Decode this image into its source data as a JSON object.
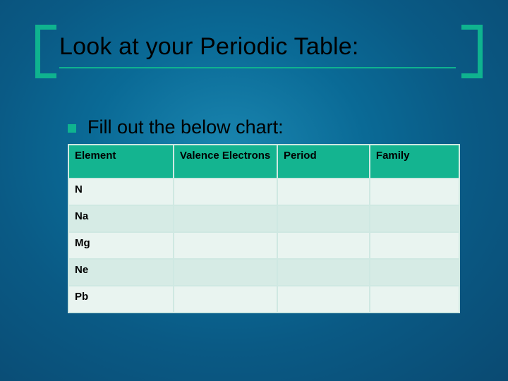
{
  "title": "Look at your Periodic Table:",
  "bullet": "Fill out the below chart:",
  "chart_data": {
    "type": "table",
    "title": "Fill out the below chart:",
    "columns": [
      "Element",
      "Valence Electrons",
      "Period",
      "Family"
    ],
    "rows": [
      {
        "element": "N",
        "valence_electrons": "",
        "period": "",
        "family": ""
      },
      {
        "element": "Na",
        "valence_electrons": "",
        "period": "",
        "family": ""
      },
      {
        "element": "Mg",
        "valence_electrons": "",
        "period": "",
        "family": ""
      },
      {
        "element": "Ne",
        "valence_electrons": "",
        "period": "",
        "family": ""
      },
      {
        "element": "Pb",
        "valence_electrons": "",
        "period": "",
        "family": ""
      }
    ]
  }
}
